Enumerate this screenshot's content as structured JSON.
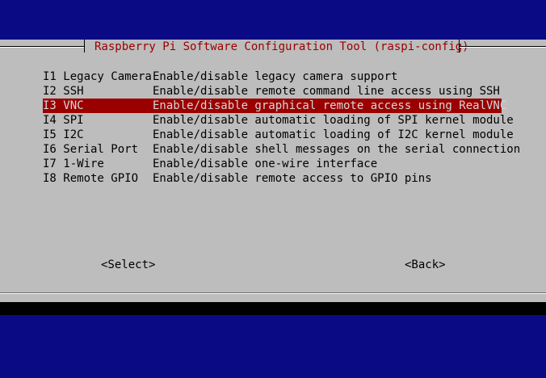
{
  "window": {
    "title": "Raspberry Pi Software Configuration Tool (raspi-config)"
  },
  "menu": {
    "items": [
      {
        "key": "I1 Legacy Camera",
        "description": "Enable/disable legacy camera support",
        "selected": false
      },
      {
        "key": "I2 SSH",
        "description": "Enable/disable remote command line access using SSH",
        "selected": false
      },
      {
        "key": "I3 VNC",
        "description": "Enable/disable graphical remote access using RealVNC",
        "selected": true
      },
      {
        "key": "I4 SPI",
        "description": "Enable/disable automatic loading of SPI kernel module",
        "selected": false
      },
      {
        "key": "I5 I2C",
        "description": "Enable/disable automatic loading of I2C kernel module",
        "selected": false
      },
      {
        "key": "I6 Serial Port",
        "description": "Enable/disable shell messages on the serial connection",
        "selected": false
      },
      {
        "key": "I7 1-Wire",
        "description": "Enable/disable one-wire interface",
        "selected": false
      },
      {
        "key": "I8 Remote GPIO",
        "description": "Enable/disable remote access to GPIO pins",
        "selected": false
      }
    ]
  },
  "buttons": {
    "select_label": "<Select>",
    "back_label": "<Back>"
  },
  "colors": {
    "background": "#0a0a84",
    "dialog": "#bdbdbd",
    "highlight": "#9a0000",
    "title_text": "#9a0000"
  }
}
